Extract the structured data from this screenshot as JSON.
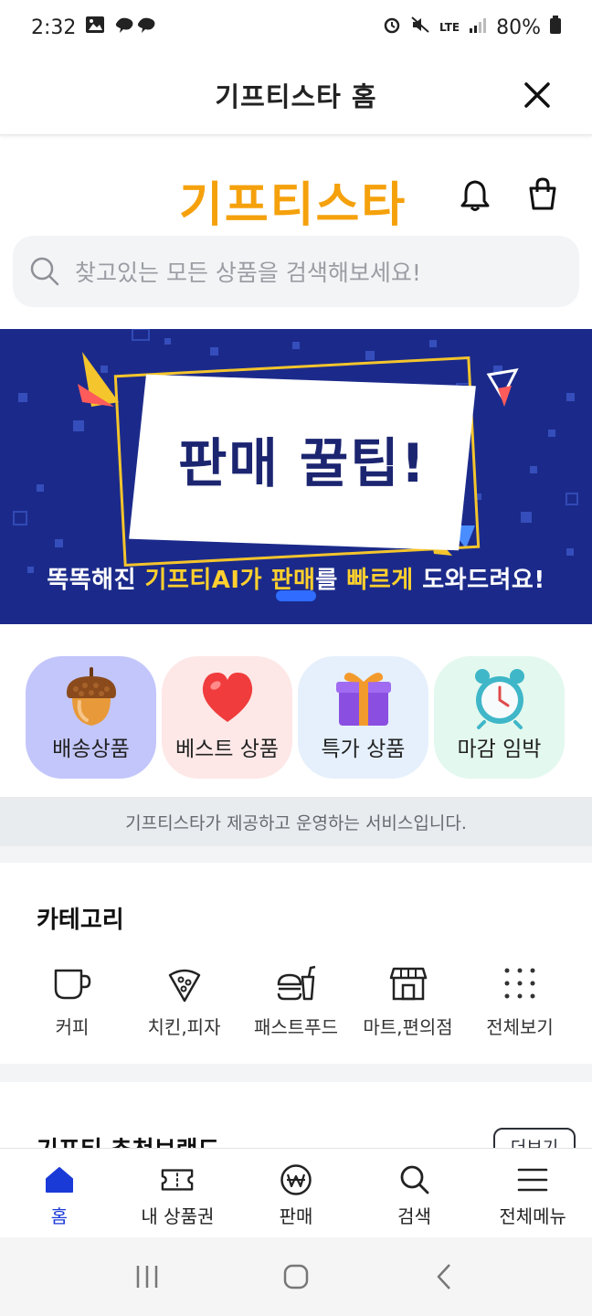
{
  "status_bar": {
    "time": "2:32",
    "battery": "80%",
    "network": "LTE"
  },
  "title_bar": {
    "title": "기프티스타 홈"
  },
  "header": {
    "logo": "기프티스타"
  },
  "search": {
    "placeholder": "찾고있는 모든 상품을 검색해보세요!"
  },
  "banner": {
    "title": "판매 꿀팁!",
    "subtitle_parts": [
      "똑똑해진 ",
      "기프티AI가 판매",
      "를 ",
      "빠르게",
      " 도와드려요!"
    ]
  },
  "quick_menu": [
    {
      "label": "배송상품",
      "icon": "acorn-icon",
      "bg": "#c3c6fb"
    },
    {
      "label": "베스트 상품",
      "icon": "heart-icon",
      "bg": "#fde8e7"
    },
    {
      "label": "특가 상품",
      "icon": "gift-icon",
      "bg": "#e5f0fc"
    },
    {
      "label": "마감 임박",
      "icon": "alarm-clock-icon",
      "bg": "#e3f8ee"
    }
  ],
  "notice": "기프티스타가 제공하고 운영하는 서비스입니다.",
  "category": {
    "title": "카테고리",
    "items": [
      {
        "label": "커피",
        "icon": "coffee-cup-icon"
      },
      {
        "label": "치킨,피자",
        "icon": "pizza-slice-icon"
      },
      {
        "label": "패스트푸드",
        "icon": "burger-drink-icon"
      },
      {
        "label": "마트,편의점",
        "icon": "store-icon"
      },
      {
        "label": "전체보기",
        "icon": "grid-dots-icon"
      }
    ]
  },
  "brand": {
    "title": "기프티 추천브랜드",
    "more_label": "더보기"
  },
  "bottom_nav": [
    {
      "label": "홈",
      "icon": "home-icon",
      "active": true
    },
    {
      "label": "내 상품권",
      "icon": "ticket-icon",
      "active": false
    },
    {
      "label": "판매",
      "icon": "won-coin-icon",
      "active": false
    },
    {
      "label": "검색",
      "icon": "search-icon",
      "active": false
    },
    {
      "label": "전체메뉴",
      "icon": "menu-icon",
      "active": false
    }
  ],
  "colors": {
    "brand": "#f5a10c",
    "banner_bg": "#1b2a8a",
    "active_nav": "#1a3ad8",
    "highlight": "#ffd02e"
  }
}
